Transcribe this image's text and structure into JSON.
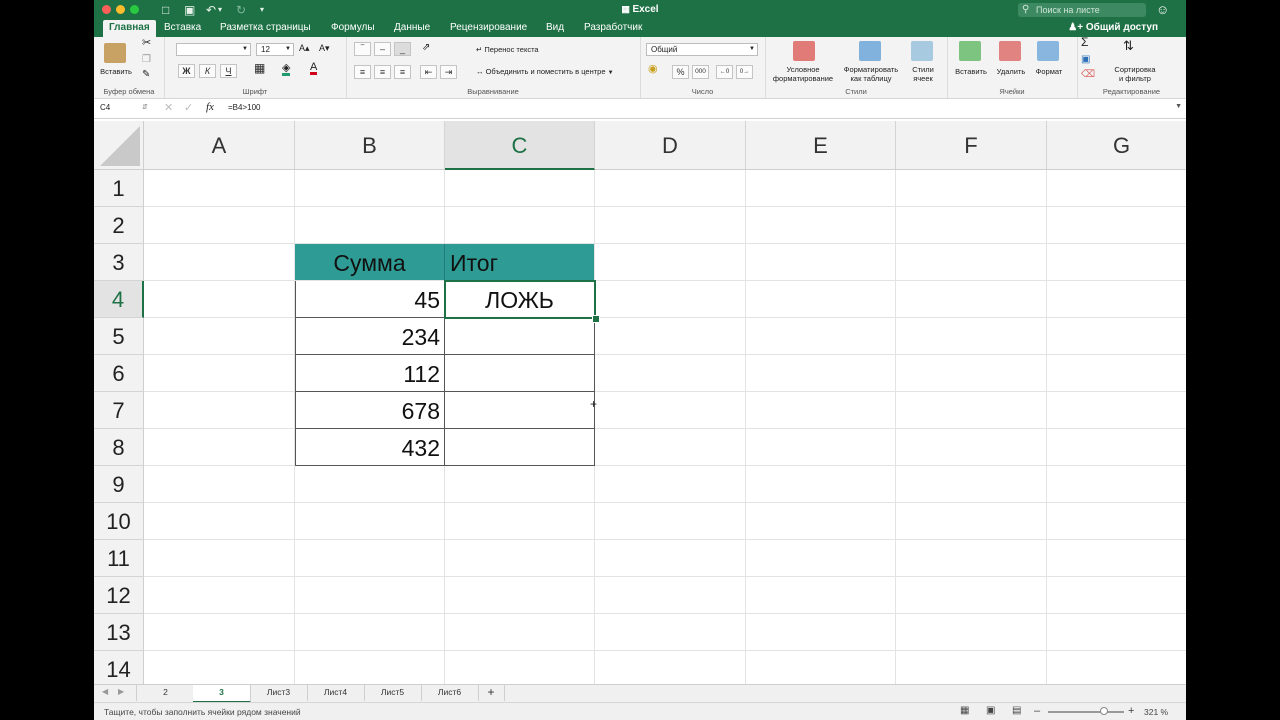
{
  "app": {
    "title": "Excel",
    "search_placeholder": "Поиск на листе",
    "share": "Общий доступ"
  },
  "colors": {
    "brand": "#1e7145",
    "header_fill": "#2e9c94",
    "accent": "#1e7145"
  },
  "tabs": [
    "Главная",
    "Вставка",
    "Разметка страницы",
    "Формулы",
    "Данные",
    "Рецензирование",
    "Вид",
    "Разработчик"
  ],
  "ribbon": {
    "clipboard": {
      "paste": "Вставить",
      "group": "Буфер обмена"
    },
    "font": {
      "size": "12",
      "bold": "Ж",
      "italic": "К",
      "underline": "Ч",
      "group": "Шрифт"
    },
    "alignment": {
      "wrap": "Перенос текста",
      "merge": "Объединить и поместить в центре",
      "group": "Выравнивание"
    },
    "number": {
      "format": "Общий",
      "percent": "%",
      "thousands": "000",
      "group": "Число"
    },
    "styles": {
      "conditional_1": "Условное",
      "conditional_2": "форматирование",
      "table_1": "Форматировать",
      "table_2": "как таблицу",
      "cell_1": "Стили",
      "cell_2": "ячеек",
      "group": "Стили"
    },
    "cells": {
      "insert": "Вставить",
      "delete": "Удалить",
      "format": "Формат",
      "group": "Ячейки"
    },
    "editing": {
      "sort_1": "Сортировка",
      "sort_2": "и фильтр",
      "group": "Редактирование"
    }
  },
  "formula_bar": {
    "name_box": "C4",
    "fx": "fx",
    "formula": "=B4>100"
  },
  "columns": [
    "A",
    "B",
    "C",
    "D",
    "E",
    "F",
    "G"
  ],
  "rows": [
    "1",
    "2",
    "3",
    "4",
    "5",
    "6",
    "7",
    "8",
    "9",
    "10",
    "11",
    "12",
    "13",
    "14"
  ],
  "table": {
    "header_sum": "Сумма",
    "header_result": "Итог",
    "values": [
      "45",
      "234",
      "112",
      "678",
      "432"
    ],
    "result_c4": "ЛОЖЬ"
  },
  "sheets": [
    "2",
    "3",
    "Лист3",
    "Лист4",
    "Лист5",
    "Лист6"
  ],
  "active_sheet": "3",
  "status": {
    "message": "Тащите, чтобы заполнить ячейки рядом значений",
    "zoom": "321 %"
  }
}
